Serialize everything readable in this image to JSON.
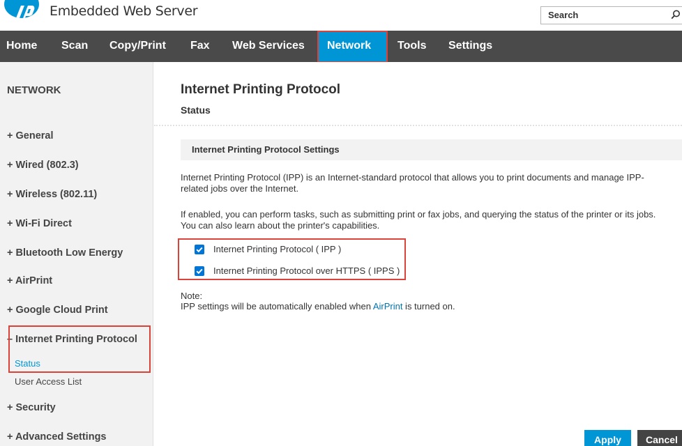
{
  "header": {
    "app_title": "Embedded Web Server",
    "search_placeholder": "Search"
  },
  "nav": {
    "items": [
      "Home",
      "Scan",
      "Copy/Print",
      "Fax",
      "Web Services",
      "Network",
      "Tools",
      "Settings"
    ],
    "active": "Network"
  },
  "sidebar": {
    "heading": "NETWORK",
    "items": [
      "+ General",
      "+ Wired (802.3)",
      "+ Wireless (802.11)",
      "+ Wi-Fi Direct",
      "+ Bluetooth Low Energy",
      "+ AirPrint",
      "+ Google Cloud Print",
      "– Internet Printing Protocol",
      "+ Security",
      "+ Advanced Settings"
    ],
    "subitems": [
      "Status",
      "User Access List"
    ]
  },
  "main": {
    "title": "Internet Printing Protocol",
    "subtitle": "Status",
    "section_title": "Internet Printing Protocol Settings",
    "para1_line1": "Internet Printing Protocol (IPP) is an Internet-standard protocol that allows you to print documents and manage IPP-",
    "para1_line2": "related jobs over the Internet.",
    "para2_line1": "If enabled, you can perform tasks, such as submitting print or fax jobs, and querying the status of the printer or its jobs.",
    "para2_line2": "You can also learn about the printer's capabilities.",
    "checkboxes": [
      {
        "label": "Internet Printing Protocol ( IPP )",
        "checked": true
      },
      {
        "label": "Internet Printing Protocol over HTTPS ( IPPS )",
        "checked": true
      }
    ],
    "note_label": "Note:",
    "note_before": "IPP settings will be automatically enabled when ",
    "note_link": "AirPrint",
    "note_after": " is turned on.",
    "apply_label": "Apply",
    "cancel_label": "Cancel"
  },
  "colors": {
    "accent": "#0096d6",
    "nav_bg": "#4a4a4a",
    "highlight": "#d9433a"
  }
}
